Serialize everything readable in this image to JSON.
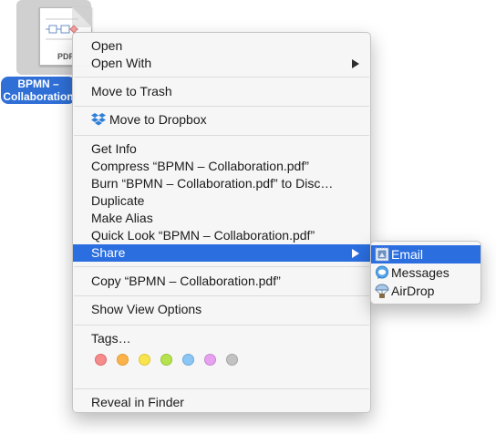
{
  "file": {
    "thumbnail_label": "PDF",
    "caption_line1": "BPMN –",
    "caption_line2": "Collaboration"
  },
  "menu": {
    "open": "Open",
    "open_with": "Open With",
    "move_to_trash": "Move to Trash",
    "move_to_dropbox": "Move to Dropbox",
    "get_info": "Get Info",
    "compress": "Compress “BPMN – Collaboration.pdf”",
    "burn": "Burn “BPMN – Collaboration.pdf” to Disc…",
    "duplicate": "Duplicate",
    "make_alias": "Make Alias",
    "quick_look": "Quick Look “BPMN – Collaboration.pdf”",
    "share": "Share",
    "copy": "Copy “BPMN – Collaboration.pdf”",
    "show_view_options": "Show View Options",
    "tags": "Tags…",
    "reveal_in_finder": "Reveal in Finder"
  },
  "tags": [
    {
      "name": "red",
      "fill": "#f58b8b",
      "stroke": "#e06a6a"
    },
    {
      "name": "orange",
      "fill": "#fbb24b",
      "stroke": "#e39a31"
    },
    {
      "name": "yellow",
      "fill": "#fae44d",
      "stroke": "#dcc633"
    },
    {
      "name": "green",
      "fill": "#b6e24b",
      "stroke": "#98c43a"
    },
    {
      "name": "blue",
      "fill": "#8cc6f4",
      "stroke": "#6aa9db"
    },
    {
      "name": "purple",
      "fill": "#e6a2ef",
      "stroke": "#c885d3"
    },
    {
      "name": "gray",
      "fill": "#c2c2c2",
      "stroke": "#a5a5a5"
    }
  ],
  "share_submenu": {
    "email": "Email",
    "messages": "Messages",
    "airdrop": "AirDrop"
  },
  "colors": {
    "highlight": "#2b6ee0",
    "caption_bg": "#2f6fd6"
  }
}
